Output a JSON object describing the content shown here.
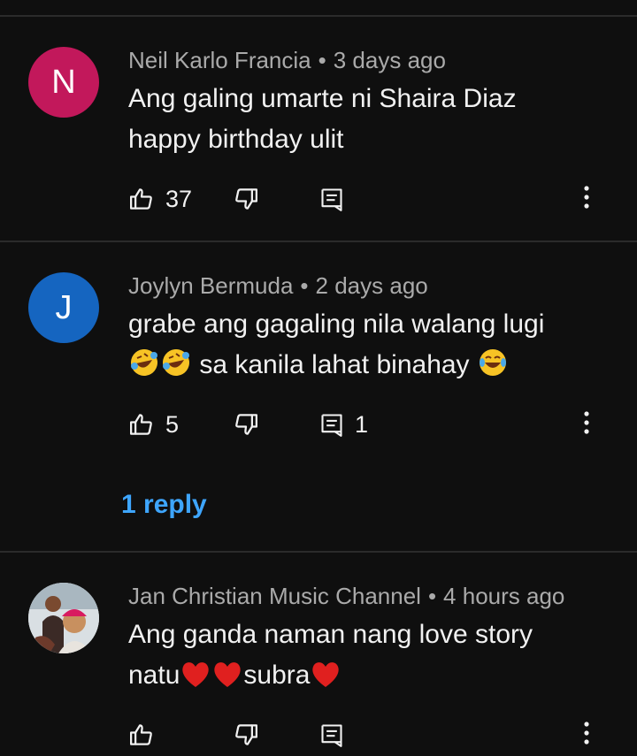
{
  "comments": [
    {
      "author": "Neil Karlo Francia",
      "time": "3 days ago",
      "avatar_letter": "N",
      "avatar_color": "#c2185b",
      "text_line1": "Ang galing umarte ni Shaira Diaz",
      "text_line2": "happy birthday ulit",
      "likes": "37",
      "replies_count": ""
    },
    {
      "author": "Joylyn Bermuda",
      "time": "2 days ago",
      "avatar_letter": "J",
      "avatar_color": "#1565c0",
      "text_line1": "grabe ang gagaling nila walang lugi",
      "text_line2": "sa kanila lahat binahay",
      "likes": "5",
      "replies_count": "1",
      "replies_link": "1 reply"
    },
    {
      "author": "Jan Christian Music Channel",
      "time": "4 hours ago",
      "text_line1": "Ang ganda naman nang love story",
      "text_line2_a": "natu",
      "text_line2_b": "subra",
      "likes": "",
      "replies_count": ""
    }
  ],
  "meta_separator": "•"
}
